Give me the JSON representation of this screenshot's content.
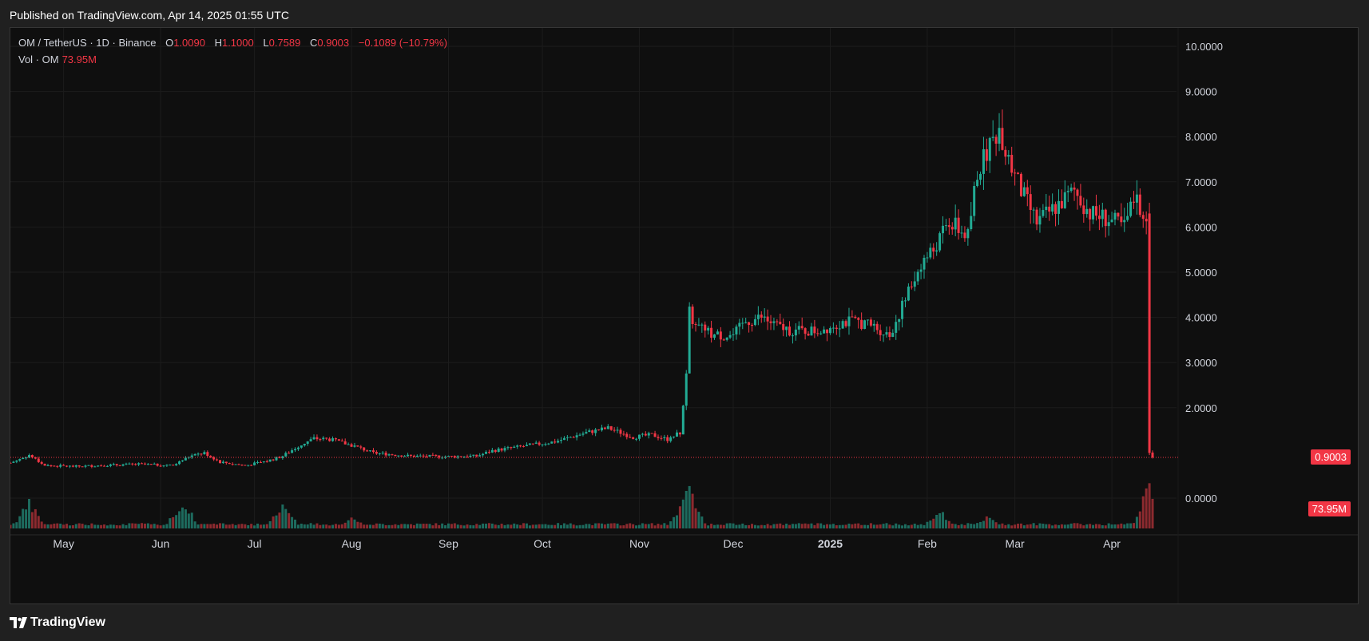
{
  "header": {
    "published": "Published on TradingView.com, Apr 14, 2025 01:55 UTC"
  },
  "legend": {
    "symbol": "OM / TetherUS · 1D · Binance",
    "open_label": "O",
    "open": "1.0090",
    "high_label": "H",
    "high": "1.1000",
    "low_label": "L",
    "low": "0.7589",
    "close_label": "C",
    "close": "0.9003",
    "change": "−0.1089 (−10.79%)",
    "vol_label": "Vol · OM",
    "vol": "73.95M"
  },
  "tags": {
    "price": "0.9003",
    "volume": "73.95M"
  },
  "brand": {
    "name": "TradingView",
    "logo": "tradingview-logo-icon"
  },
  "colors": {
    "up": "#22ab94",
    "down": "#f23645",
    "up_vol": "#1d6b5e",
    "down_vol": "#8c2a2f",
    "background": "#0f0f0f",
    "grid": "#1c1c1c",
    "axis_text": "#d1d4dc"
  },
  "chart_data": {
    "type": "candlestick",
    "title": "OM / TetherUS · 1D · Binance",
    "y_ticks": [
      "10.0000",
      "9.0000",
      "8.0000",
      "7.0000",
      "6.0000",
      "5.0000",
      "4.0000",
      "3.0000",
      "2.0000",
      "0.0000"
    ],
    "ylim": [
      0,
      10
    ],
    "x_ticks": [
      "May",
      "Jun",
      "Jul",
      "Aug",
      "Sep",
      "Oct",
      "Nov",
      "Dec",
      "2025",
      "Feb",
      "Mar",
      "Apr"
    ],
    "x_range": [
      "2024-04-14",
      "2025-04-14"
    ],
    "grid": true,
    "last_price": 0.9003,
    "last_volume": "73.95M",
    "price_path": [
      [
        "2024-04-14",
        0.78
      ],
      [
        "2024-04-20",
        0.95
      ],
      [
        "2024-04-25",
        0.72
      ],
      [
        "2024-05-05",
        0.7
      ],
      [
        "2024-05-15",
        0.73
      ],
      [
        "2024-05-25",
        0.75
      ],
      [
        "2024-06-05",
        0.72
      ],
      [
        "2024-06-10",
        0.92
      ],
      [
        "2024-06-15",
        1.0
      ],
      [
        "2024-06-20",
        0.8
      ],
      [
        "2024-06-28",
        0.72
      ],
      [
        "2024-07-05",
        0.82
      ],
      [
        "2024-07-10",
        0.93
      ],
      [
        "2024-07-15",
        1.15
      ],
      [
        "2024-07-20",
        1.32
      ],
      [
        "2024-07-25",
        1.3
      ],
      [
        "2024-08-02",
        1.15
      ],
      [
        "2024-08-08",
        1.0
      ],
      [
        "2024-08-20",
        0.93
      ],
      [
        "2024-09-01",
        0.92
      ],
      [
        "2024-09-10",
        0.93
      ],
      [
        "2024-09-15",
        1.05
      ],
      [
        "2024-09-25",
        1.15
      ],
      [
        "2024-10-05",
        1.25
      ],
      [
        "2024-10-15",
        1.45
      ],
      [
        "2024-10-22",
        1.55
      ],
      [
        "2024-10-30",
        1.35
      ],
      [
        "2024-11-05",
        1.4
      ],
      [
        "2024-11-10",
        1.3
      ],
      [
        "2024-11-14",
        1.45
      ],
      [
        "2024-11-16",
        2.7
      ],
      [
        "2024-11-17",
        4.1
      ],
      [
        "2024-11-19",
        3.8
      ],
      [
        "2024-11-25",
        3.6
      ],
      [
        "2024-12-01",
        3.6
      ],
      [
        "2024-12-05",
        3.9
      ],
      [
        "2024-12-10",
        4.0
      ],
      [
        "2024-12-15",
        3.8
      ],
      [
        "2024-12-20",
        3.7
      ],
      [
        "2024-12-28",
        3.7
      ],
      [
        "2025-01-05",
        3.9
      ],
      [
        "2025-01-10",
        3.9
      ],
      [
        "2025-01-15",
        3.8
      ],
      [
        "2025-01-20",
        3.6
      ],
      [
        "2025-01-25",
        4.4
      ],
      [
        "2025-01-30",
        5.2
      ],
      [
        "2025-02-03",
        5.5
      ],
      [
        "2025-02-08",
        6.1
      ],
      [
        "2025-02-14",
        5.8
      ],
      [
        "2025-02-17",
        7.2
      ],
      [
        "2025-02-21",
        7.8
      ],
      [
        "2025-02-24",
        8.2
      ],
      [
        "2025-02-28",
        7.3
      ],
      [
        "2025-03-03",
        6.8
      ],
      [
        "2025-03-08",
        6.1
      ],
      [
        "2025-03-15",
        6.5
      ],
      [
        "2025-03-20",
        6.8
      ],
      [
        "2025-03-25",
        6.3
      ],
      [
        "2025-03-30",
        6.2
      ],
      [
        "2025-04-05",
        6.0
      ],
      [
        "2025-04-08",
        6.6
      ],
      [
        "2025-04-12",
        6.3
      ],
      [
        "2025-04-13",
        0.95
      ],
      [
        "2025-04-14",
        0.9003
      ]
    ],
    "series": [
      {
        "name": "Vol · OM",
        "type": "volume",
        "x": [
          "2024-04-20",
          "2024-06-08",
          "2024-07-10",
          "2024-08-01",
          "2024-11-15",
          "2024-11-17",
          "2025-02-05",
          "2025-02-20",
          "2025-04-13"
        ],
        "values_relative": [
          0.6,
          0.65,
          0.6,
          0.25,
          0.55,
          0.95,
          0.4,
          0.3,
          1.0
        ]
      }
    ]
  }
}
